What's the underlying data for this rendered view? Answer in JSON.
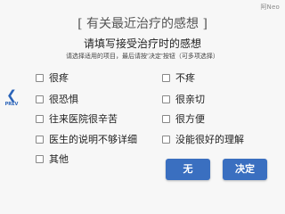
{
  "logo": "阿Neo",
  "title": "[ 有关最近治疗的感想 ]",
  "subtitle": "请填写接受治疗时的感想",
  "instruction": "请选择适用的项目，最后请按'决定'按钮（可多项选择）",
  "nav": {
    "prev_label": "PREV",
    "prev_icon": "chevron-left-icon"
  },
  "options_left": [
    "很疼",
    "很恐惧",
    "往来医院很辛苦",
    "医生的说明不够详细",
    "其他"
  ],
  "options_right": [
    "不疼",
    "很亲切",
    "很方便",
    "没能很好的理解"
  ],
  "buttons": {
    "none_label": "无",
    "decide_label": "决定"
  },
  "colors": {
    "accent": "#3a6fc0"
  }
}
